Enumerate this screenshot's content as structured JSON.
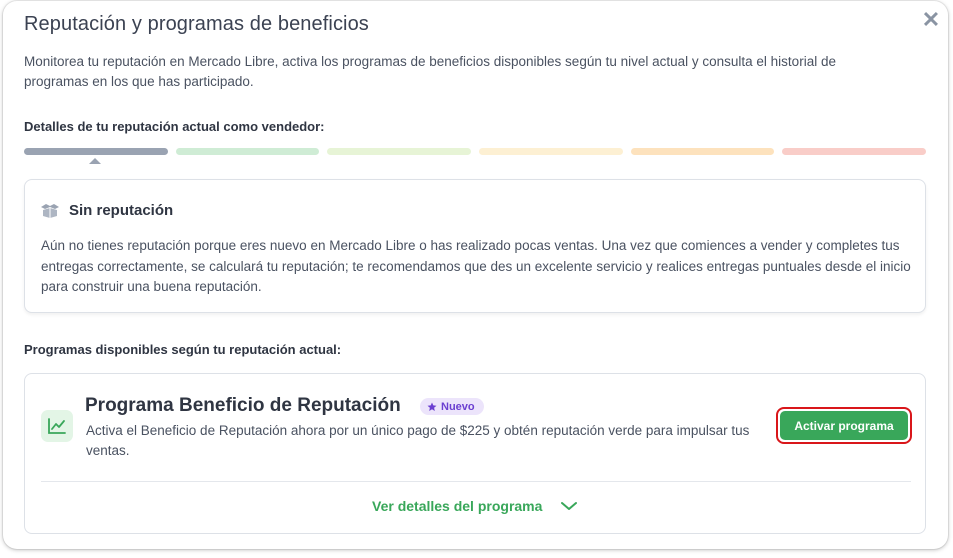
{
  "modal": {
    "title": "Reputación y programas de beneficios",
    "close_icon": "close-icon",
    "description": "Monitorea tu reputación en Mercado Libre, activa los programas de beneficios disponibles según tu nivel actual y consulta el historial de programas en los que has participado."
  },
  "reputation": {
    "label": "Detalles de tu reputación actual como vendedor:",
    "scale_colors": [
      "#9aa3b2",
      "#cfecd5",
      "#e7f4d6",
      "#fdf0d3",
      "#fde2bd",
      "#f9cdc8"
    ],
    "current_level_index": 0,
    "card": {
      "icon": "box-icon",
      "title": "Sin reputación",
      "text": "Aún no tienes reputación porque eres nuevo en Mercado Libre o has realizado pocas ventas. Una vez que comiences a vender y completes tus entregas correctamente, se calculará tu reputación; te recomendamos que des un excelente servicio y realices entregas puntuales desde el inicio para construir una buena reputación."
    }
  },
  "programs": {
    "label": "Programas disponibles según tu reputación actual:",
    "items": [
      {
        "icon": "trend-chart-icon",
        "title": "Programa Beneficio de Reputación",
        "badge": "Nuevo",
        "badge_icon": "star-icon",
        "description": "Activa el Beneficio de Reputación ahora por un único pago de $225 y obtén reputación verde para impulsar tus ventas.",
        "button_label": "Activar programa",
        "details_label": "Ver detalles del programa",
        "details_icon": "chevron-down-icon"
      }
    ]
  },
  "colors": {
    "accent_green": "#39a75a",
    "badge_purple": "#6b3fd1",
    "highlight_red": "#d9161a"
  }
}
